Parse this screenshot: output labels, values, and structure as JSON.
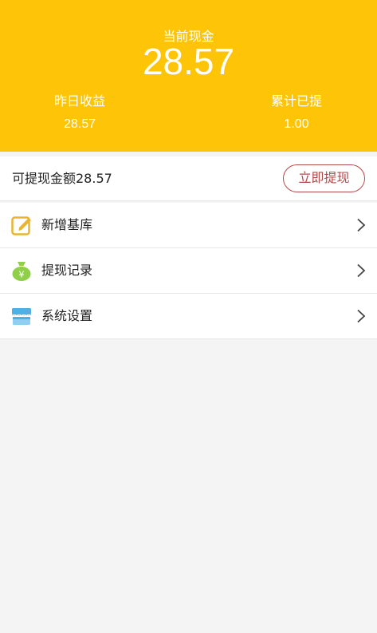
{
  "header": {
    "current_cash_label": "当前现金",
    "current_cash_amount": "28.57",
    "yesterday_earnings_label": "昨日收益",
    "yesterday_earnings_value": "28.57",
    "total_withdrawn_label": "累计已提",
    "total_withdrawn_value": "1.00",
    "background_color": "#fec408"
  },
  "withdraw": {
    "available_text": "可提现金额28.57",
    "button_label": "立即提现",
    "button_color": "#b04a4a"
  },
  "menu": {
    "items": [
      {
        "label": "新增基库",
        "icon": "edit-note-icon"
      },
      {
        "label": "提现记录",
        "icon": "money-bag-icon"
      },
      {
        "label": "系统设置",
        "icon": "storefront-icon"
      }
    ]
  }
}
